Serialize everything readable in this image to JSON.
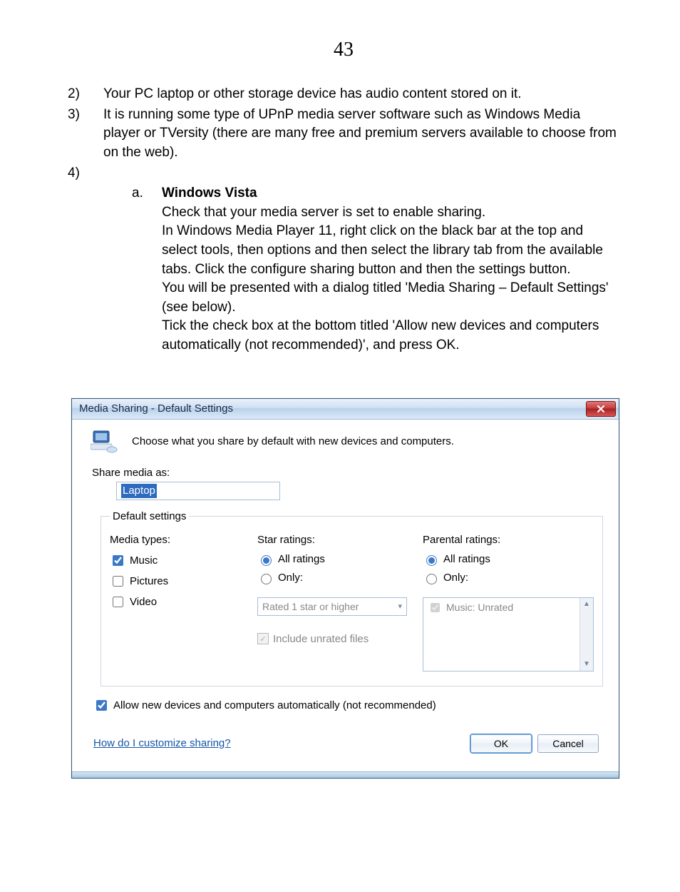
{
  "page_number": "43",
  "items": {
    "num2": "2)",
    "text2": "Your PC laptop or other storage device has audio content stored on it.",
    "num3": "3)",
    "text3": "It is running some type of UPnP media server software such as Windows Media player or TVersity (there are many free and premium servers available to choose from on the web).",
    "num4": "4)",
    "sub_letter": "a.",
    "sub_title": "Windows Vista",
    "sub_body1": "Check that your media server is set to enable sharing.",
    "sub_body2": "In Windows Media Player 11, right click on the black bar at the top and select tools, then options and then select the library tab from the available tabs. Click the configure sharing button and then the settings button.",
    "sub_body3": "You will be presented with a dialog titled 'Media Sharing – Default Settings' (see below).",
    "sub_body4": "Tick the check box at the bottom titled 'Allow new devices and computers automatically (not recommended)', and press OK."
  },
  "dialog": {
    "title": "Media Sharing - Default Settings",
    "intro": "Choose what you share by default with new devices and computers.",
    "share_label": "Share media as:",
    "share_value": "Laptop",
    "fieldset_legend": "Default settings",
    "media_types_heading": "Media types:",
    "media_types": {
      "music": "Music",
      "pictures": "Pictures",
      "video": "Video"
    },
    "star_heading": "Star ratings:",
    "star_all": "All ratings",
    "star_only": "Only:",
    "star_combo": "Rated 1 star or higher",
    "include_unrated": "Include unrated files",
    "parental_heading": "Parental ratings:",
    "parental_all": "All ratings",
    "parental_only": "Only:",
    "parental_list_item": "Music: Unrated",
    "allow_label": "Allow new devices and computers automatically (not recommended)",
    "help_link": "How do I customize sharing?",
    "ok": "OK",
    "cancel": "Cancel"
  }
}
